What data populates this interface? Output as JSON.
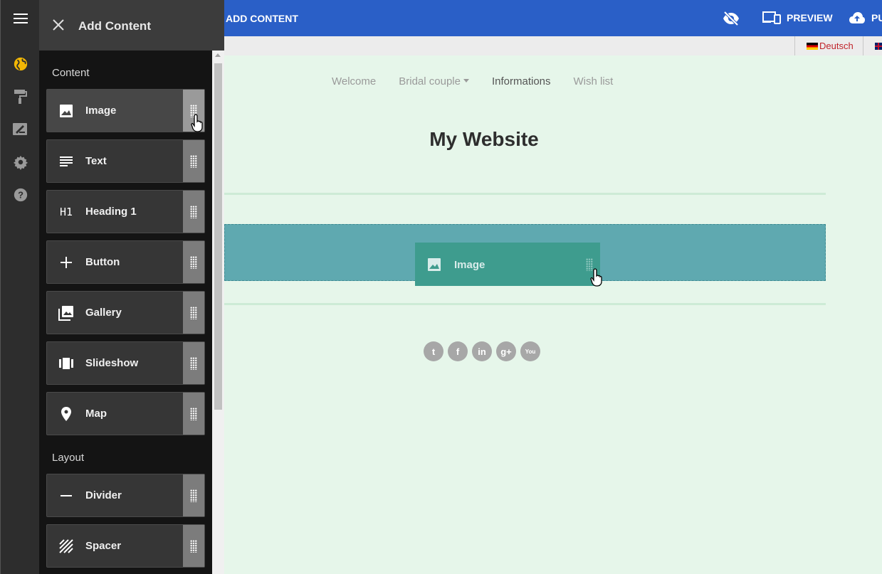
{
  "panel": {
    "title": "Add Content",
    "sections": {
      "content_label": "Content",
      "layout_label": "Layout"
    },
    "content_items": [
      {
        "label": "Image",
        "icon": "image-icon"
      },
      {
        "label": "Text",
        "icon": "text-icon"
      },
      {
        "label": "Heading 1",
        "icon": "heading-icon",
        "icon_text": "H1"
      },
      {
        "label": "Button",
        "icon": "plus-icon"
      },
      {
        "label": "Gallery",
        "icon": "gallery-icon"
      },
      {
        "label": "Slideshow",
        "icon": "slideshow-icon"
      },
      {
        "label": "Map",
        "icon": "map-pin-icon"
      }
    ],
    "layout_items": [
      {
        "label": "Divider",
        "icon": "minus-icon"
      },
      {
        "label": "Spacer",
        "icon": "spacer-icon"
      }
    ]
  },
  "topbar": {
    "add_content": "ADD CONTENT",
    "preview": "PREVIEW",
    "publish_partial": "PU"
  },
  "languages": {
    "de": "Deutsch"
  },
  "site": {
    "nav": [
      "Welcome",
      "Bridal couple",
      "Informations",
      "Wish list"
    ],
    "title": "My Website",
    "drag_label": "Image",
    "social": [
      "twitter",
      "facebook",
      "linkedin",
      "google-plus",
      "youtube"
    ],
    "social_glyphs": [
      "t",
      "f",
      "in",
      "g+",
      "You"
    ]
  },
  "colors": {
    "topbar": "#2a5fc7",
    "panel": "#141414",
    "accent_globe": "#f2b705",
    "dropzone": "#5fa9b0",
    "page_bg": "#e6f6ea"
  }
}
